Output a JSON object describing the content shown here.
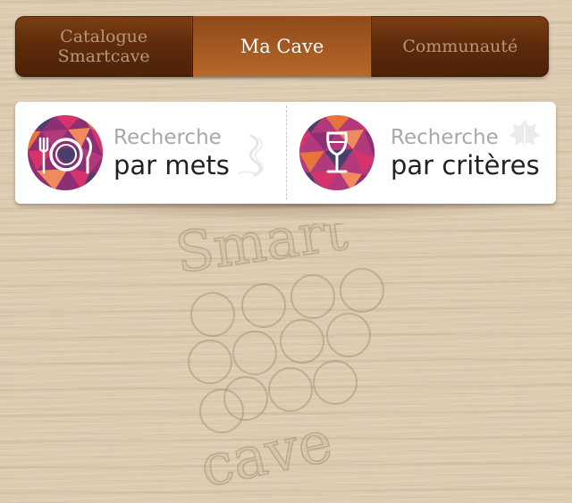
{
  "tabs": [
    {
      "label": "Catalogue\nSmartcave",
      "active": false
    },
    {
      "label": "Ma Cave",
      "active": true
    },
    {
      "label": "Communauté",
      "active": false
    }
  ],
  "search_options": {
    "mets": {
      "small": "Recherche",
      "big": "par mets",
      "icon": "plate-fork-knife-icon"
    },
    "criteres": {
      "small": "Recherche",
      "big": "par critères",
      "icon": "wine-glass-icon"
    }
  },
  "watermark": {
    "top": "Smart",
    "bottom": "cave"
  },
  "colors": {
    "tab_dark": "#5e2c0b",
    "tab_active": "#a65a22",
    "wood": "#dccbb0",
    "icon_palette": [
      "#d6336c",
      "#8e2f73",
      "#e8743b",
      "#4a3f6b",
      "#b23a7a",
      "#f08a5d"
    ]
  }
}
